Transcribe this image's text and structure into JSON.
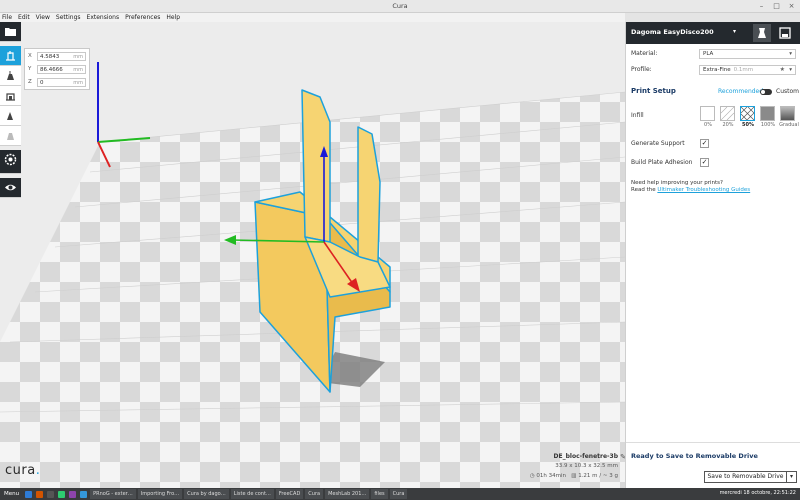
{
  "window": {
    "title": "Cura"
  },
  "menu": [
    "File",
    "Edit",
    "View",
    "Settings",
    "Extensions",
    "Preferences",
    "Help"
  ],
  "move_panel": {
    "x": {
      "axis": "X",
      "value": "4.5843",
      "unit": "mm"
    },
    "y": {
      "axis": "Y",
      "value": "86.4666",
      "unit": "mm"
    },
    "z": {
      "axis": "Z",
      "value": "0",
      "unit": "mm"
    }
  },
  "object": {
    "name": "DE_bloc-fenetre-3b",
    "dims": "33.9 x 10.3 x 32.5 mm",
    "time": "01h 34min",
    "material_usage": "1.21 m / ~ 3 g"
  },
  "logo": {
    "text": "cura",
    "dot": "."
  },
  "sidebar": {
    "printer": "Dagoma EasyDisco200",
    "material_label": "Material:",
    "material_value": "PLA",
    "profile_label": "Profile:",
    "profile_value": "Extra-Fine",
    "profile_sub": "0.1mm",
    "print_setup": "Print Setup",
    "mode_recommended": "Recommended",
    "mode_custom": "Custom",
    "infill_label": "Infill",
    "infill_options": [
      {
        "label": "0%"
      },
      {
        "label": "20%"
      },
      {
        "label": "50%",
        "selected": true
      },
      {
        "label": "100%"
      },
      {
        "label": "Gradual"
      }
    ],
    "support_label": "Generate Support",
    "support_checked": "✓",
    "adhesion_label": "Build Plate Adhesion",
    "adhesion_checked": "✓",
    "help_line1": "Need help improving your prints?",
    "help_line2_prefix": "Read the",
    "help_link": "Ultimaker Troubleshooting Guides",
    "ready_text": "Ready to Save to Removable Drive",
    "save_button": "Save to Removable Drive",
    "save_arrow": "▾"
  },
  "taskbar": {
    "menu": "Menu",
    "windows": [
      "PRnoG - exter…",
      "Importing Fro…",
      "Cura by dago…",
      "Liste de cont…",
      "FreeCAD",
      "Cura",
      "MeshLab 201…",
      "files",
      "Cura"
    ],
    "clock": "mercredi 18 octobre, 22:51:22"
  },
  "colors": {
    "accent": "#1da1db",
    "model_fill": "#f6cf6a",
    "model_outline": "#1da1db",
    "header_dark": "#24292e"
  }
}
